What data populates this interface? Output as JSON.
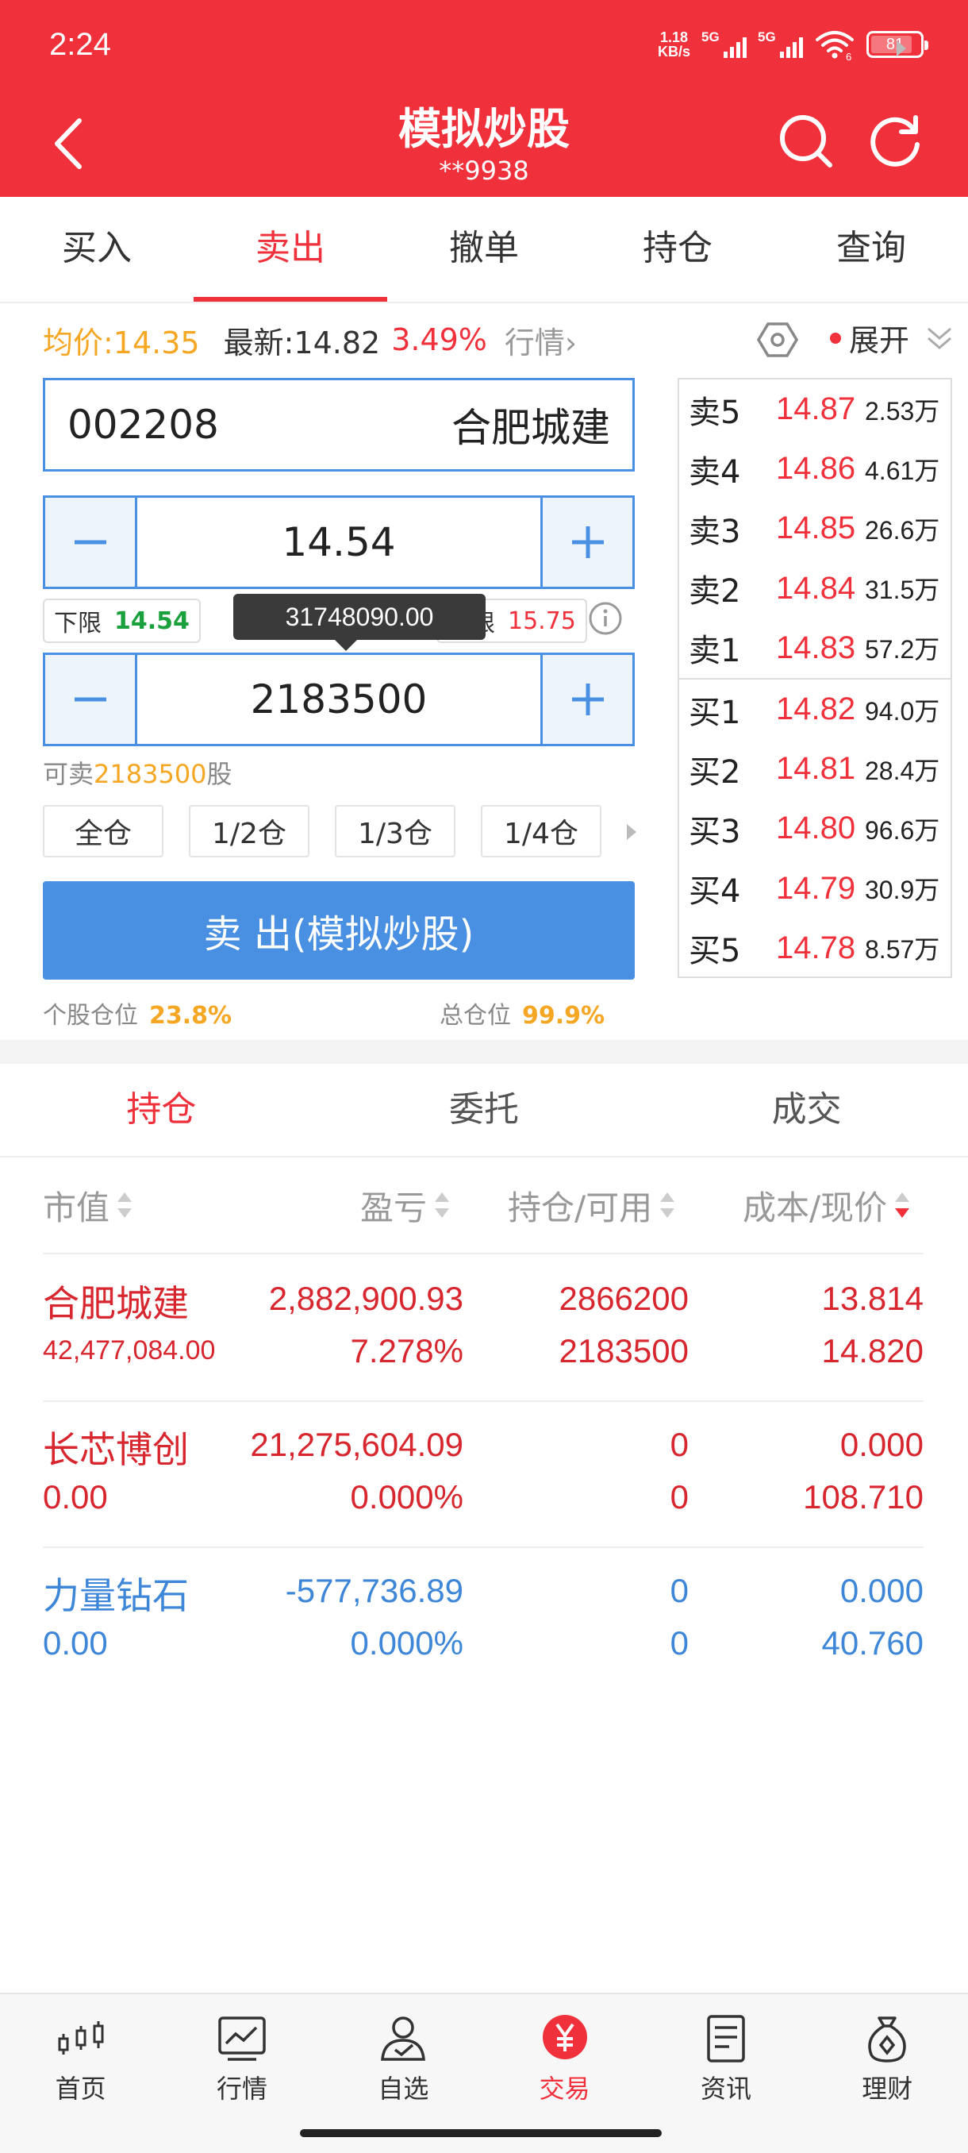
{
  "status_bar": {
    "time": "2:24",
    "net_speed_top": "1.18",
    "net_speed_bottom": "KB/s",
    "sim1": "5G",
    "sim2": "5G",
    "wifi_badge": "6",
    "battery": "81"
  },
  "header": {
    "title": "模拟炒股",
    "account": "**9938"
  },
  "tabs": [
    {
      "label": "买入"
    },
    {
      "label": "卖出",
      "active": true
    },
    {
      "label": "撤单"
    },
    {
      "label": "持仓"
    },
    {
      "label": "查询"
    }
  ],
  "info": {
    "avg_price": "均价:14.35",
    "latest": "最新:14.82",
    "change_pct": "3.49%",
    "market_link": "行情",
    "expand": "展开"
  },
  "form": {
    "code": "002208",
    "name": "合肥城建",
    "price": "14.54",
    "lower_label": "下限",
    "lower_value": "14.54",
    "upper_label": "上限",
    "upper_value": "15.75",
    "tooltip": "31748090.00",
    "quantity": "2183500",
    "avail_prefix": "可卖",
    "avail_value": "2183500",
    "avail_suffix": "股",
    "ratios": [
      "全仓",
      "1/2仓",
      "1/3仓",
      "1/4仓"
    ],
    "sell_button": "卖 出(模拟炒股)",
    "stock_position_label": "个股仓位",
    "stock_position_value": "23.8%",
    "total_position_label": "总仓位",
    "total_position_value": "99.9%"
  },
  "order_book": {
    "sell": [
      {
        "label": "卖5",
        "price": "14.87",
        "vol": "2.53万"
      },
      {
        "label": "卖4",
        "price": "14.86",
        "vol": "4.61万"
      },
      {
        "label": "卖3",
        "price": "14.85",
        "vol": "26.6万"
      },
      {
        "label": "卖2",
        "price": "14.84",
        "vol": "31.5万"
      },
      {
        "label": "卖1",
        "price": "14.83",
        "vol": "57.2万"
      }
    ],
    "buy": [
      {
        "label": "买1",
        "price": "14.82",
        "vol": "94.0万"
      },
      {
        "label": "买2",
        "price": "14.81",
        "vol": "28.4万"
      },
      {
        "label": "买3",
        "price": "14.80",
        "vol": "96.6万"
      },
      {
        "label": "买4",
        "price": "14.79",
        "vol": "30.9万"
      },
      {
        "label": "买5",
        "price": "14.78",
        "vol": "8.57万"
      }
    ]
  },
  "subtabs": [
    {
      "label": "持仓",
      "active": true
    },
    {
      "label": "委托"
    },
    {
      "label": "成交"
    }
  ],
  "table": {
    "headers": [
      "市值",
      "盈亏",
      "持仓/可用",
      "成本/现价"
    ],
    "rows": [
      {
        "name": "合肥城建",
        "market_value": "42,477,084.00",
        "pnl": "2,882,900.93",
        "pnl_pct": "7.278%",
        "hold": "2866200",
        "avail": "2183500",
        "cost": "13.814",
        "price": "14.820",
        "color": "red"
      },
      {
        "name": "长芯博创",
        "market_value": "0.00",
        "pnl": "21,275,604.09",
        "pnl_pct": "0.000%",
        "hold": "0",
        "avail": "0",
        "cost": "0.000",
        "price": "108.710",
        "color": "red"
      },
      {
        "name": "力量钻石",
        "market_value": "0.00",
        "pnl": "-577,736.89",
        "pnl_pct": "0.000%",
        "hold": "0",
        "avail": "0",
        "cost": "0.000",
        "price": "40.760",
        "color": "blue"
      }
    ]
  },
  "bottom_nav": [
    {
      "label": "首页",
      "icon": "candlestick-icon"
    },
    {
      "label": "行情",
      "icon": "chart-icon"
    },
    {
      "label": "自选",
      "icon": "person-check-icon"
    },
    {
      "label": "交易",
      "icon": "yuan-icon",
      "active": true
    },
    {
      "label": "资讯",
      "icon": "document-icon"
    },
    {
      "label": "理财",
      "icon": "money-bag-icon"
    }
  ],
  "colors": {
    "brand_red": "#f0313b",
    "accent_blue": "#4a90e2",
    "orange": "#f5a623",
    "green": "#1aa03c"
  }
}
